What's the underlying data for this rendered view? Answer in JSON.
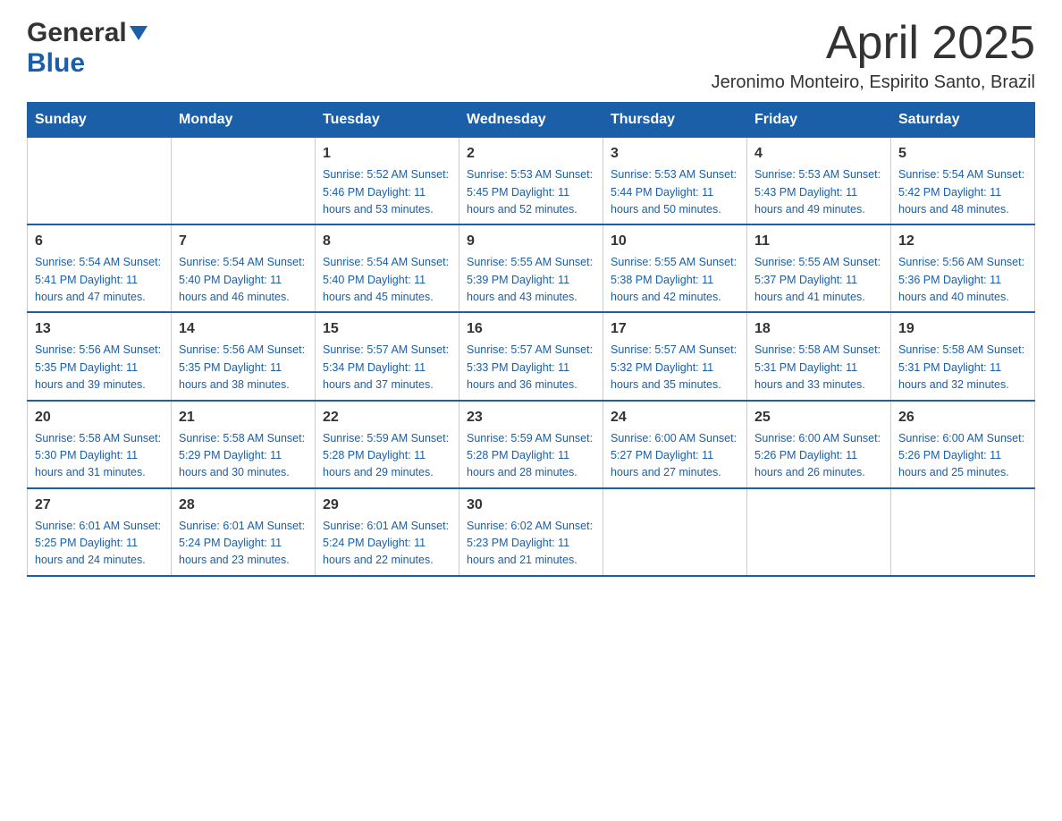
{
  "header": {
    "logo_general": "General",
    "logo_blue": "Blue",
    "month_year": "April 2025",
    "location": "Jeronimo Monteiro, Espirito Santo, Brazil"
  },
  "days_of_week": [
    "Sunday",
    "Monday",
    "Tuesday",
    "Wednesday",
    "Thursday",
    "Friday",
    "Saturday"
  ],
  "weeks": [
    [
      {
        "day": "",
        "info": ""
      },
      {
        "day": "",
        "info": ""
      },
      {
        "day": "1",
        "info": "Sunrise: 5:52 AM\nSunset: 5:46 PM\nDaylight: 11 hours\nand 53 minutes."
      },
      {
        "day": "2",
        "info": "Sunrise: 5:53 AM\nSunset: 5:45 PM\nDaylight: 11 hours\nand 52 minutes."
      },
      {
        "day": "3",
        "info": "Sunrise: 5:53 AM\nSunset: 5:44 PM\nDaylight: 11 hours\nand 50 minutes."
      },
      {
        "day": "4",
        "info": "Sunrise: 5:53 AM\nSunset: 5:43 PM\nDaylight: 11 hours\nand 49 minutes."
      },
      {
        "day": "5",
        "info": "Sunrise: 5:54 AM\nSunset: 5:42 PM\nDaylight: 11 hours\nand 48 minutes."
      }
    ],
    [
      {
        "day": "6",
        "info": "Sunrise: 5:54 AM\nSunset: 5:41 PM\nDaylight: 11 hours\nand 47 minutes."
      },
      {
        "day": "7",
        "info": "Sunrise: 5:54 AM\nSunset: 5:40 PM\nDaylight: 11 hours\nand 46 minutes."
      },
      {
        "day": "8",
        "info": "Sunrise: 5:54 AM\nSunset: 5:40 PM\nDaylight: 11 hours\nand 45 minutes."
      },
      {
        "day": "9",
        "info": "Sunrise: 5:55 AM\nSunset: 5:39 PM\nDaylight: 11 hours\nand 43 minutes."
      },
      {
        "day": "10",
        "info": "Sunrise: 5:55 AM\nSunset: 5:38 PM\nDaylight: 11 hours\nand 42 minutes."
      },
      {
        "day": "11",
        "info": "Sunrise: 5:55 AM\nSunset: 5:37 PM\nDaylight: 11 hours\nand 41 minutes."
      },
      {
        "day": "12",
        "info": "Sunrise: 5:56 AM\nSunset: 5:36 PM\nDaylight: 11 hours\nand 40 minutes."
      }
    ],
    [
      {
        "day": "13",
        "info": "Sunrise: 5:56 AM\nSunset: 5:35 PM\nDaylight: 11 hours\nand 39 minutes."
      },
      {
        "day": "14",
        "info": "Sunrise: 5:56 AM\nSunset: 5:35 PM\nDaylight: 11 hours\nand 38 minutes."
      },
      {
        "day": "15",
        "info": "Sunrise: 5:57 AM\nSunset: 5:34 PM\nDaylight: 11 hours\nand 37 minutes."
      },
      {
        "day": "16",
        "info": "Sunrise: 5:57 AM\nSunset: 5:33 PM\nDaylight: 11 hours\nand 36 minutes."
      },
      {
        "day": "17",
        "info": "Sunrise: 5:57 AM\nSunset: 5:32 PM\nDaylight: 11 hours\nand 35 minutes."
      },
      {
        "day": "18",
        "info": "Sunrise: 5:58 AM\nSunset: 5:31 PM\nDaylight: 11 hours\nand 33 minutes."
      },
      {
        "day": "19",
        "info": "Sunrise: 5:58 AM\nSunset: 5:31 PM\nDaylight: 11 hours\nand 32 minutes."
      }
    ],
    [
      {
        "day": "20",
        "info": "Sunrise: 5:58 AM\nSunset: 5:30 PM\nDaylight: 11 hours\nand 31 minutes."
      },
      {
        "day": "21",
        "info": "Sunrise: 5:58 AM\nSunset: 5:29 PM\nDaylight: 11 hours\nand 30 minutes."
      },
      {
        "day": "22",
        "info": "Sunrise: 5:59 AM\nSunset: 5:28 PM\nDaylight: 11 hours\nand 29 minutes."
      },
      {
        "day": "23",
        "info": "Sunrise: 5:59 AM\nSunset: 5:28 PM\nDaylight: 11 hours\nand 28 minutes."
      },
      {
        "day": "24",
        "info": "Sunrise: 6:00 AM\nSunset: 5:27 PM\nDaylight: 11 hours\nand 27 minutes."
      },
      {
        "day": "25",
        "info": "Sunrise: 6:00 AM\nSunset: 5:26 PM\nDaylight: 11 hours\nand 26 minutes."
      },
      {
        "day": "26",
        "info": "Sunrise: 6:00 AM\nSunset: 5:26 PM\nDaylight: 11 hours\nand 25 minutes."
      }
    ],
    [
      {
        "day": "27",
        "info": "Sunrise: 6:01 AM\nSunset: 5:25 PM\nDaylight: 11 hours\nand 24 minutes."
      },
      {
        "day": "28",
        "info": "Sunrise: 6:01 AM\nSunset: 5:24 PM\nDaylight: 11 hours\nand 23 minutes."
      },
      {
        "day": "29",
        "info": "Sunrise: 6:01 AM\nSunset: 5:24 PM\nDaylight: 11 hours\nand 22 minutes."
      },
      {
        "day": "30",
        "info": "Sunrise: 6:02 AM\nSunset: 5:23 PM\nDaylight: 11 hours\nand 21 minutes."
      },
      {
        "day": "",
        "info": ""
      },
      {
        "day": "",
        "info": ""
      },
      {
        "day": "",
        "info": ""
      }
    ]
  ]
}
